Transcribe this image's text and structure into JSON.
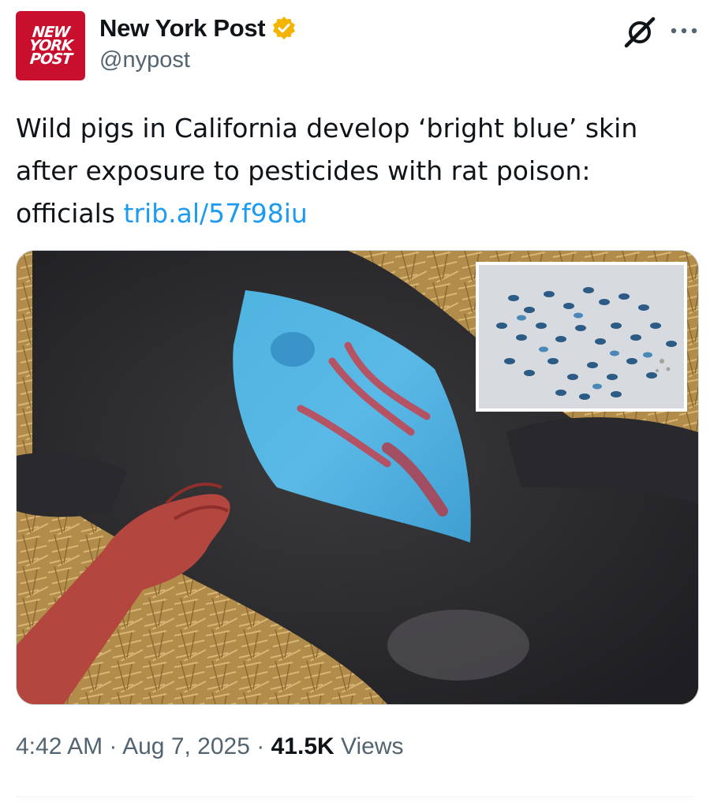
{
  "author": {
    "avatar_text": [
      "NEW",
      "YORK",
      "POST"
    ],
    "display_name": "New York Post",
    "handle": "@nypost",
    "verified_badge_color": "#f4b400"
  },
  "header_icons": {
    "grok": "grok-icon",
    "more": "more-horizontal-icon"
  },
  "tweet": {
    "text": "Wild pigs in California develop ‘bright blue’ skin after exposure to pesticides with rat poison: officials",
    "link": "trib.al/57f98iu",
    "link_color": "#1d9bf0"
  },
  "media": {
    "main_image": "wild-pig-blue-skin-photo",
    "inset_image": "blue-pellets-photo"
  },
  "meta": {
    "time": "4:42 AM",
    "separator": "·",
    "date": "Aug 7, 2025",
    "views_count": "41.5K",
    "views_label": "Views"
  }
}
